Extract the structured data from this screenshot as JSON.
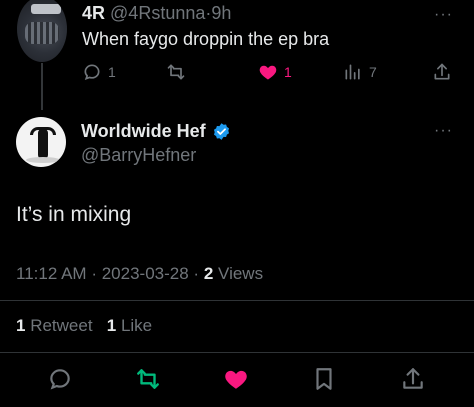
{
  "parent_tweet": {
    "display_name": "4R",
    "handle": "@4Rstunna",
    "separator": "·",
    "time_ago": "9h",
    "text": "When faygo droppin the ep bra",
    "more": "···",
    "reply_count": "1",
    "retweet_count": "",
    "like_count": "1",
    "views_count": "7",
    "like_color": "#f91880"
  },
  "main_tweet": {
    "display_name": "Worldwide Hef",
    "handle": "@BarryHefner",
    "more": "···",
    "text": "It’s in mixing",
    "time": "11:12 AM",
    "date": "2023-03-28",
    "separator": "·",
    "views_count": "2",
    "views_label": "Views",
    "retweet_count": "1",
    "retweet_label": "Retweet",
    "like_count": "1",
    "like_label": "Like",
    "verified_color": "#1d9bf0"
  },
  "bottom_actions": [
    "reply-icon",
    "retweet-icon",
    "like-icon",
    "bookmark-icon",
    "share-icon"
  ],
  "colors": {
    "background": "#000000",
    "text": "#e7e9ea",
    "muted": "#71767b",
    "retweet_active": "#00ba7c",
    "like_active": "#f91880"
  }
}
